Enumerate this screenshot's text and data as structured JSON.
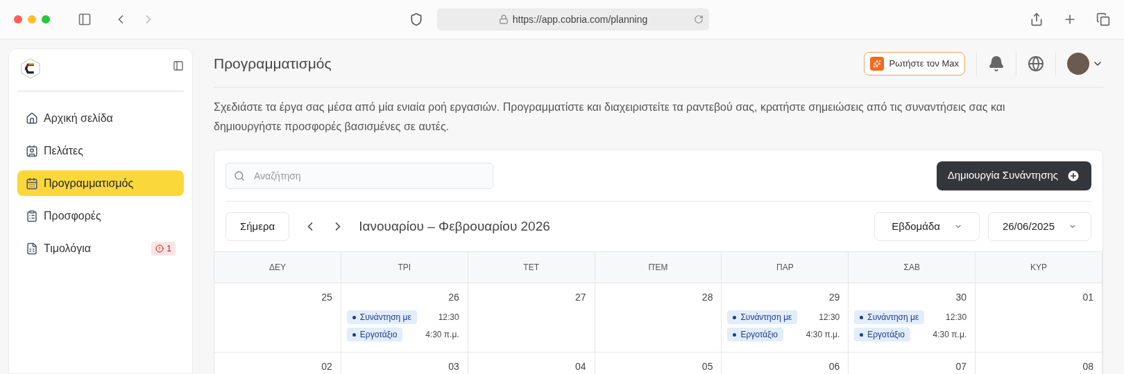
{
  "browser": {
    "url": "https://app.cobria.com/planning"
  },
  "sidebar": {
    "items": [
      {
        "kind": "home",
        "label": "Αρχική σελίδα",
        "selected": false
      },
      {
        "kind": "contacts",
        "label": "Πελάτες",
        "selected": false
      },
      {
        "kind": "calendar",
        "label": "Προγραμματισμός",
        "selected": true
      },
      {
        "kind": "clipboard",
        "label": "Προσφορές",
        "selected": false
      },
      {
        "kind": "invoice",
        "label": "Τιμολόγια",
        "selected": false,
        "badge": "1"
      }
    ]
  },
  "header": {
    "title": "Προγραμματισμός",
    "ask_button": "Ρωτήστε τον Max"
  },
  "description": "Σχεδιάστε τα έργα σας μέσα από μία ενιαία ροή εργασιών. Προγραμματίστε και διαχειριστείτε τα ραντεβού σας, κρατήστε σημειώσεις από τις συναντήσεις σας και δημιουργήστε προσφορές βασισμένες σε αυτές.",
  "calendar": {
    "search": {
      "placeholder": "Αναζήτηση"
    },
    "create_button": "Δημιουργία Συνάντησης",
    "today_button": "Σήμερα",
    "range_title": "Ιανουαρίου – Φεβρουαρίου 2026",
    "view_select": "Εβδομάδα",
    "date_select": "26/06/2025",
    "weekdays": [
      "ΔΕΥ",
      "ΤΡΙ",
      "ΤΕΤ",
      "ΠΈΜ",
      "ΠΑΡ",
      "ΣΑΒ",
      "ΚΥΡ"
    ],
    "weeks": [
      [
        {
          "day": "25"
        },
        {
          "day": "26",
          "events": [
            {
              "title": "Συνάντηση με",
              "time": "12:30"
            },
            {
              "title": "Εργοτάξιο",
              "time": "4:30 π.μ."
            }
          ]
        },
        {
          "day": "27"
        },
        {
          "day": "28"
        },
        {
          "day": "29",
          "events": [
            {
              "title": "Συνάντηση με",
              "time": "12:30"
            },
            {
              "title": "Εργοτάξιο",
              "time": "4:30 π.μ."
            }
          ]
        },
        {
          "day": "30",
          "events": [
            {
              "title": "Συνάντηση με",
              "time": "12:30"
            },
            {
              "title": "Εργοτάξιο",
              "time": "4:30 π.μ."
            }
          ]
        },
        {
          "day": "01"
        }
      ],
      [
        {
          "day": "02"
        },
        {
          "day": "03"
        },
        {
          "day": "04"
        },
        {
          "day": "05"
        },
        {
          "day": "06"
        },
        {
          "day": "07"
        },
        {
          "day": "08"
        }
      ]
    ]
  }
}
